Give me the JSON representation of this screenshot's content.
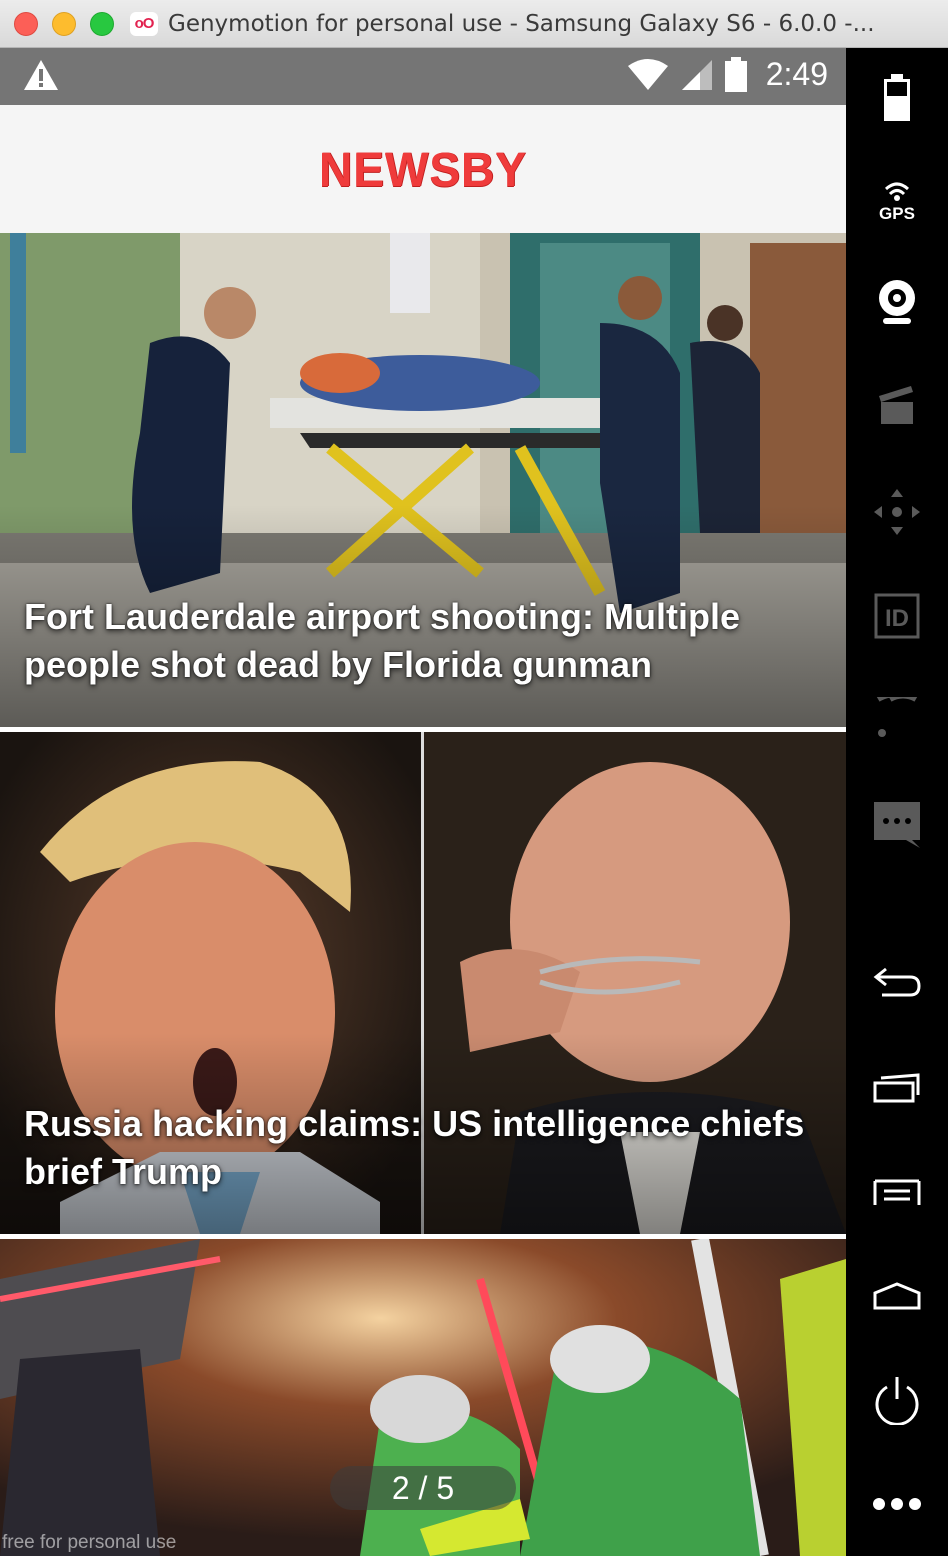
{
  "window": {
    "title": "Genymotion for personal use - Samsung Galaxy S6 - 6.0.0 -...",
    "app_logo": "oO"
  },
  "statusbar": {
    "time": "2:49",
    "icons": [
      "warning-icon",
      "wifi-icon",
      "signal-icon",
      "battery-icon"
    ]
  },
  "app": {
    "brand": "NEWSBY"
  },
  "articles": [
    {
      "headline": "Fort Lauderdale airport shooting: Multiple people shot dead by Florida gunman"
    },
    {
      "headline": "Russia hacking claims: US intelligence chiefs brief Trump"
    },
    {
      "headline": ""
    }
  ],
  "pager": {
    "text": "2 / 5"
  },
  "watermark": "free for personal use",
  "sidebar": {
    "gps_label": "GPS",
    "id_label": "ID",
    "tools": [
      "battery-icon",
      "gps-icon",
      "webcam-icon",
      "capture-icon",
      "dpad-icon",
      "identifiers-icon",
      "cast-icon",
      "sms-icon",
      "back-icon",
      "recent-apps-icon",
      "menu-icon",
      "home-icon",
      "power-icon",
      "more-icon"
    ]
  }
}
